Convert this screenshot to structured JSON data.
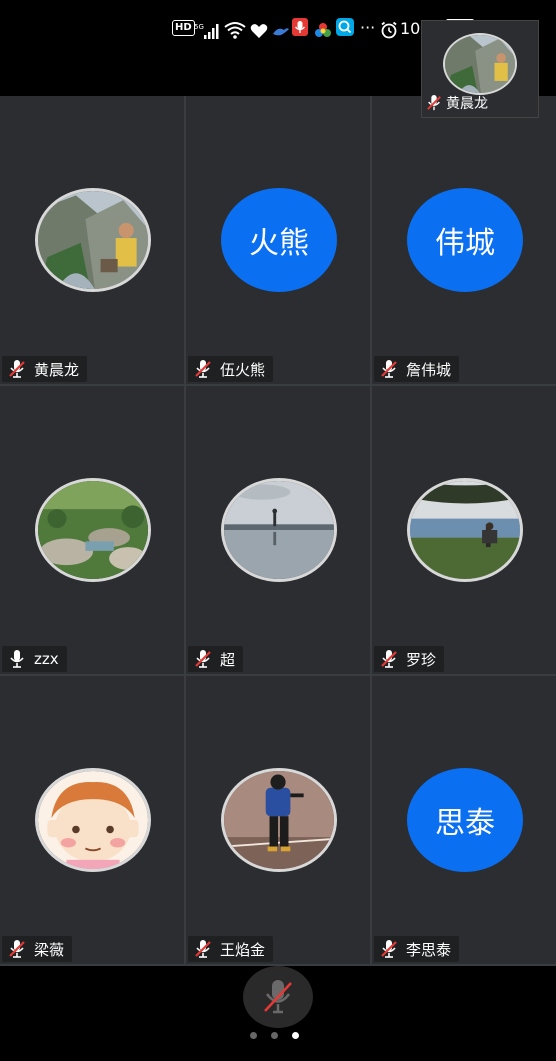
{
  "status_bar": {
    "hd": "HD",
    "network": "5G",
    "dots": "···",
    "battery_text": "100%",
    "battery_level": 1.0,
    "time": "10:00"
  },
  "self_view": {
    "name": "黄晨龙",
    "muted": true
  },
  "participants": [
    {
      "name": "黄晨龙",
      "avatar_type": "photo",
      "photo": "mountain-gorge",
      "muted": true
    },
    {
      "name": "伍火熊",
      "avatar_type": "initials",
      "initials": "火熊",
      "muted": true
    },
    {
      "name": "詹伟城",
      "avatar_type": "initials",
      "initials": "伟城",
      "muted": true
    },
    {
      "name": "zzx",
      "avatar_type": "photo",
      "photo": "garden-rocks",
      "muted": false
    },
    {
      "name": "超",
      "avatar_type": "photo",
      "photo": "lake-reflection",
      "muted": true
    },
    {
      "name": "罗珍",
      "avatar_type": "photo",
      "photo": "lakeside-tree",
      "muted": true
    },
    {
      "name": "梁薇",
      "avatar_type": "photo",
      "photo": "cartoon-girl",
      "muted": true
    },
    {
      "name": "王焰金",
      "avatar_type": "photo",
      "photo": "child-backpack",
      "muted": true
    },
    {
      "name": "李思泰",
      "avatar_type": "initials",
      "initials": "思泰",
      "muted": true
    }
  ],
  "bottom_bar": {
    "mute_button": "microphone-muted-icon",
    "pages": 3,
    "active_page": 3
  },
  "colors": {
    "background": "#000000",
    "tile": "#2b2d30",
    "grid_line": "#3a3d40",
    "avatar_blue": "#0a6ff0",
    "muted_red": "#e53935"
  }
}
